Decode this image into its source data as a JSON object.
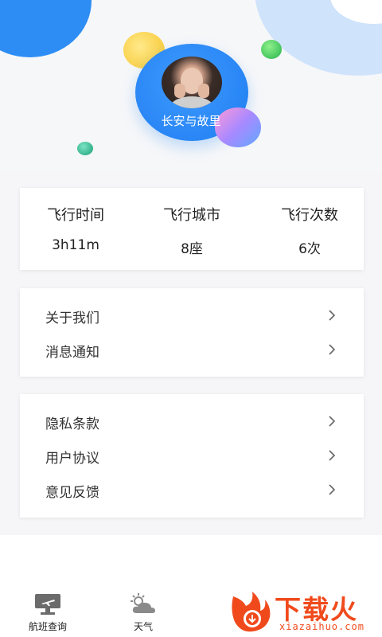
{
  "profile": {
    "username": "长安与故里"
  },
  "stats": [
    {
      "label": "飞行时间",
      "value": "3h11m"
    },
    {
      "label": "飞行城市",
      "value": "8座"
    },
    {
      "label": "飞行次数",
      "value": "6次"
    }
  ],
  "menu_group_1": [
    {
      "label": "关于我们"
    },
    {
      "label": "消息通知"
    }
  ],
  "menu_group_2": [
    {
      "label": "隐私条款"
    },
    {
      "label": "用户协议"
    },
    {
      "label": "意见反馈"
    }
  ],
  "tabbar": {
    "tabs": [
      {
        "label": "航班查询",
        "icon": "flight-board-icon"
      },
      {
        "label": "天气",
        "icon": "weather-icon"
      }
    ]
  },
  "watermark": {
    "title": "下载火",
    "subtitle": "xiazaihuo.com"
  },
  "colors": {
    "accent": "#2d8df4",
    "brand_watermark": "#f04a1c"
  }
}
